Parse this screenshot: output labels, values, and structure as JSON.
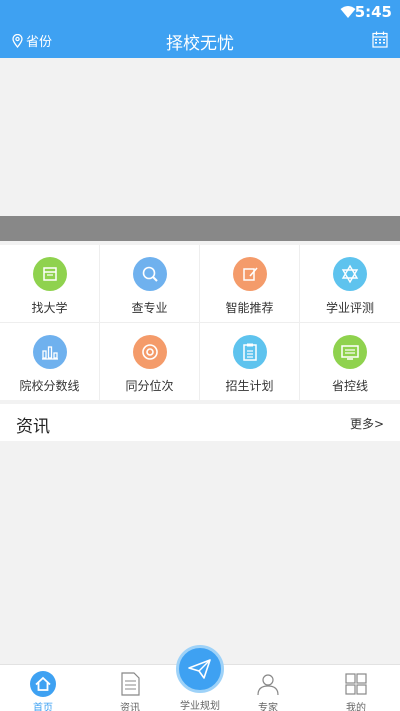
{
  "status_bar": {
    "time": "5:45"
  },
  "header": {
    "province_label": "省份",
    "title": "择校无忧"
  },
  "grid": [
    {
      "label": "找大学",
      "icon": "calendar-book-icon",
      "color": "#8fd24e"
    },
    {
      "label": "查专业",
      "icon": "magnifier-icon",
      "color": "#6fb1ee"
    },
    {
      "label": "智能推荐",
      "icon": "pencil-note-icon",
      "color": "#f49b6a"
    },
    {
      "label": "学业评测",
      "icon": "star-of-david-icon",
      "color": "#5ec3ee"
    },
    {
      "label": "院校分数线",
      "icon": "bar-chart-icon",
      "color": "#6fb1ee"
    },
    {
      "label": "同分位次",
      "icon": "lifebuoy-icon",
      "color": "#f49b6a"
    },
    {
      "label": "招生计划",
      "icon": "clipboard-icon",
      "color": "#5ec3ee"
    },
    {
      "label": "省控线",
      "icon": "monitor-icon",
      "color": "#8fd24e"
    }
  ],
  "news": {
    "title": "资讯",
    "more": "更多>"
  },
  "bottom_nav": {
    "home": "首页",
    "news": "资讯",
    "plan": "学业规划",
    "expert": "专家",
    "mine": "我的"
  },
  "colors": {
    "primary": "#3ea1f2",
    "banner_strip": "#888888"
  }
}
